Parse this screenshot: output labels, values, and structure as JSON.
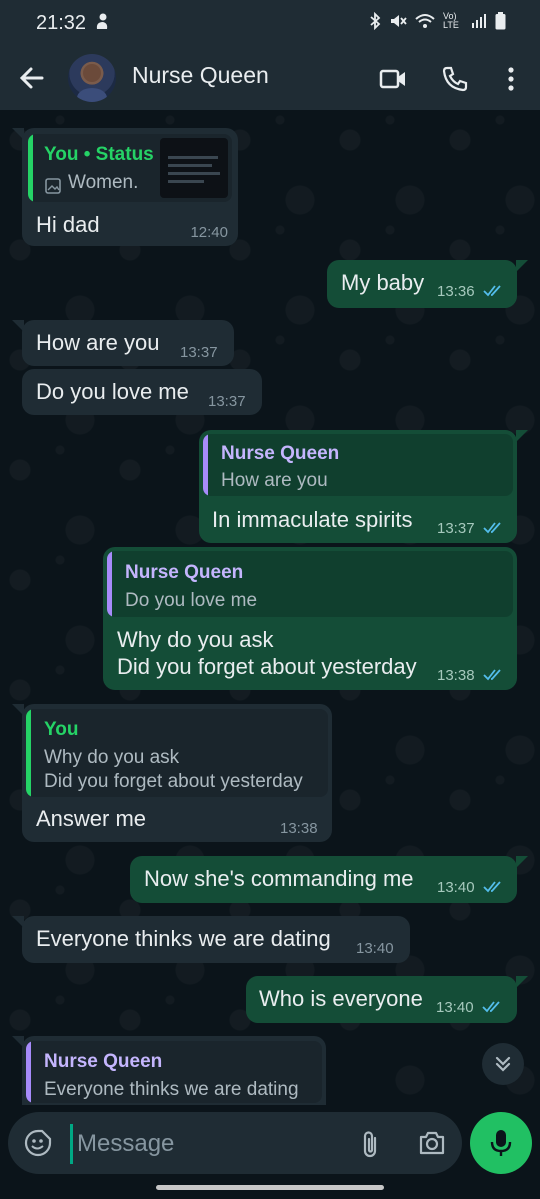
{
  "status_bar": {
    "time": "21:32",
    "icons": [
      "bluetooth-icon",
      "mute-icon",
      "wifi-icon",
      "volte-icon",
      "signal-icon",
      "battery-icon"
    ],
    "volte_label": "Vo) LTE"
  },
  "header": {
    "contact_name": "Nurse Queen",
    "icons": [
      "back-arrow-icon",
      "video-call-icon",
      "voice-call-icon",
      "more-vert-icon"
    ]
  },
  "messages": [
    {
      "dir": "in",
      "quote_name": "You • Status",
      "quote_text": "Women.",
      "text": "Hi dad",
      "time": "12:40"
    },
    {
      "dir": "out",
      "text": "My baby",
      "time": "13:36"
    },
    {
      "dir": "in",
      "text": "How are you",
      "time": "13:37"
    },
    {
      "dir": "in",
      "text": "Do you love me",
      "time": "13:37"
    },
    {
      "dir": "out",
      "quote_name": "Nurse Queen",
      "quote_text": "How are you",
      "text": "In immaculate spirits",
      "time": "13:37"
    },
    {
      "dir": "out",
      "quote_name": "Nurse Queen",
      "quote_text": "Do you love me",
      "text_line1": "Why do you ask",
      "text_line2": "Did you forget about yesterday",
      "time": "13:38"
    },
    {
      "dir": "in",
      "quote_name": "You",
      "quote_line1": "Why do you ask",
      "quote_line2": "Did you forget about yesterday",
      "text": "Answer me",
      "time": "13:38"
    },
    {
      "dir": "out",
      "text": "Now she's commanding me",
      "time": "13:40"
    },
    {
      "dir": "in",
      "text": "Everyone thinks we are dating",
      "time": "13:40"
    },
    {
      "dir": "out",
      "text": "Who is everyone",
      "time": "13:40"
    },
    {
      "dir": "in",
      "quote_name": "Nurse Queen",
      "quote_text": "Everyone thinks we are dating"
    }
  ],
  "composer": {
    "placeholder": "Message"
  },
  "colors": {
    "accent_green": "#21c063",
    "status_quote_green": "#25d366",
    "quote_purple": "#a78bfa",
    "read_tick_blue": "#53bdeb"
  }
}
